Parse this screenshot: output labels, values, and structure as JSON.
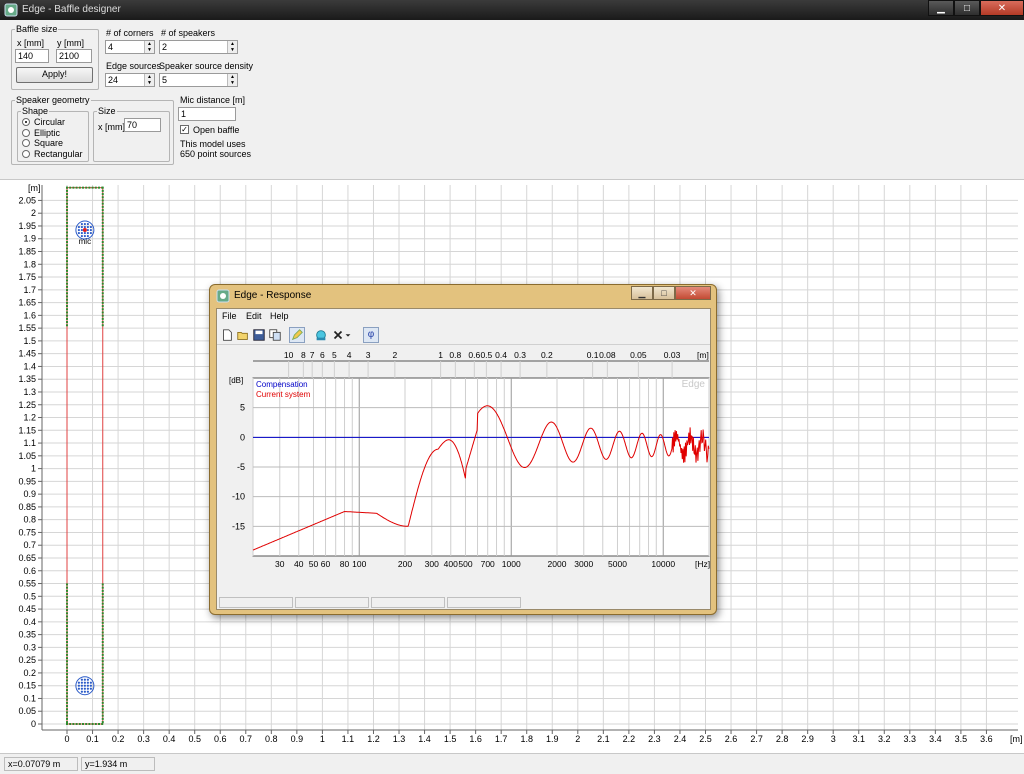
{
  "window": {
    "title": "Edge - Baffle designer",
    "minimize": "▁",
    "maximize": "□",
    "close": "✕"
  },
  "baffle_size": {
    "legend": "Baffle size",
    "x_label": "x [mm]",
    "y_label": "y [mm]",
    "x_value": "140",
    "y_value": "2100",
    "apply_label": "Apply!"
  },
  "corners": {
    "label": "# of corners",
    "value": "4"
  },
  "speakers": {
    "label": "# of speakers",
    "value": "2"
  },
  "edge_sources": {
    "label": "Edge sources",
    "value": "24"
  },
  "source_density": {
    "label": "Speaker source density",
    "value": "5"
  },
  "speaker_geometry": {
    "legend": "Speaker geometry",
    "shape_legend": "Shape",
    "shapes": [
      "Circular",
      "Elliptic",
      "Square",
      "Rectangular"
    ],
    "selected_shape": "Circular",
    "size_legend": "Size",
    "size_x_label": "x [mm]",
    "size_x_value": "70"
  },
  "mic": {
    "distance_label": "Mic distance [m]",
    "distance_value": "1",
    "open_baffle_label": "Open baffle",
    "open_baffle_checked": true,
    "model_info_line1": "This model uses",
    "model_info_line2": "650 point sources"
  },
  "plot": {
    "y_unit": "[m]",
    "mic_label": "mic",
    "y_ticks": [
      "2.05",
      "2",
      "1.95",
      "1.9",
      "1.85",
      "1.8",
      "1.75",
      "1.7",
      "1.65",
      "1.6",
      "1.55",
      "1.5",
      "1.45",
      "1.4",
      "1.35",
      "1.3",
      "1.25",
      "1.2",
      "1.15",
      "1.1",
      "1.05",
      "1",
      "0.95",
      "0.9",
      "0.85",
      "0.8",
      "0.75",
      "0.7",
      "0.65",
      "0.6",
      "0.55",
      "0.5",
      "0.45",
      "0.4",
      "0.35",
      "0.3",
      "0.25",
      "0.2",
      "0.15",
      "0.1",
      "0.05",
      "0"
    ],
    "x_ticks": [
      "0",
      "0.1",
      "0.2",
      "0.3",
      "0.4",
      "0.5",
      "0.6",
      "0.7",
      "0.8",
      "0.9",
      "1",
      "1.1",
      "1.2",
      "1.3",
      "1.4",
      "1.5",
      "1.6",
      "1.7",
      "1.8",
      "1.9",
      "2",
      "2.1",
      "2.2",
      "2.3",
      "2.4",
      "2.5",
      "2.6",
      "2.7",
      "2.8",
      "2.9",
      "3",
      "3.1",
      "3.2",
      "3.3",
      "3.4",
      "3.5",
      "3.6"
    ],
    "x_unit": "[m]",
    "baffle_color": "#2e8b2e",
    "edge_color": "#e04040"
  },
  "status": {
    "x": "x=0.07079 m",
    "y": "y=1.934 m"
  },
  "response": {
    "title": "Edge - Response",
    "menu": [
      "File",
      "Edit",
      "Help"
    ],
    "tools": [
      "new-icon",
      "open-icon",
      "save-icon",
      "copy-icon",
      "pencil-icon",
      "speaker-icon",
      "delete-icon",
      "dropdown-icon",
      "phase-icon"
    ],
    "phase_glyph": "φ",
    "db_unit": "[dB]",
    "hz_unit": "[Hz]",
    "m_unit": "[m]",
    "watermark": "Edge",
    "legend_compensation": "Compensation",
    "legend_current": "Current system",
    "compensation_color": "#0000c8",
    "current_color": "#e00000",
    "db_ticks": [
      "5",
      "0",
      "-5",
      "-10",
      "-15"
    ],
    "hz_ticks": [
      "30",
      "40",
      "50",
      "60",
      "80",
      "100",
      "200",
      "300",
      "400",
      "500",
      "700",
      "1000",
      "2000",
      "3000",
      "5000",
      "10000"
    ],
    "m_ticks": [
      "10",
      "8",
      "7",
      "6",
      "5",
      "4",
      "3",
      "2",
      "1",
      "0.8",
      "0.6",
      "0.5",
      "0.4",
      "0.3",
      "0.2",
      "0.1",
      "0.08",
      "0.05",
      "0.03"
    ]
  }
}
